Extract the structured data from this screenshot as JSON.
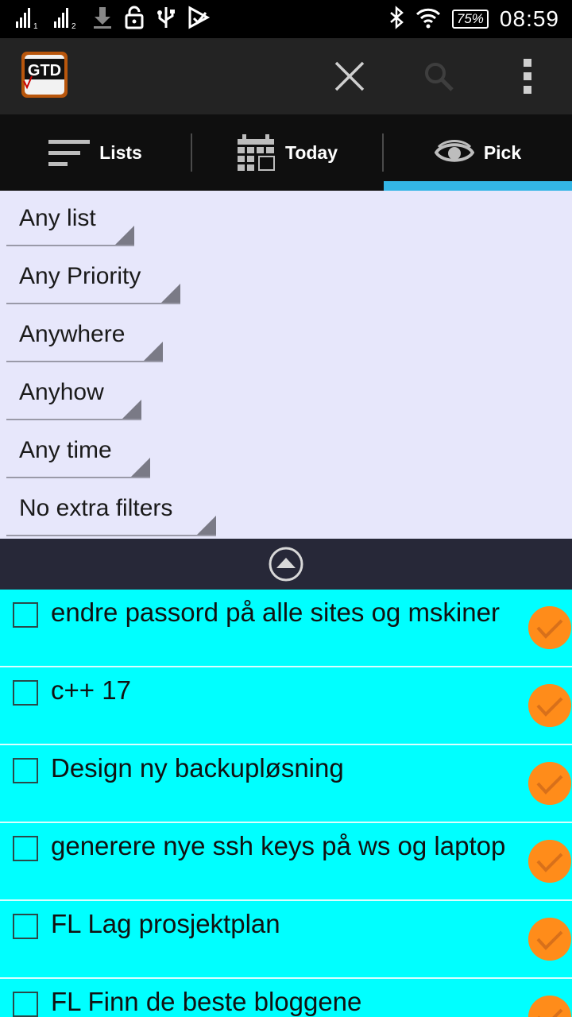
{
  "status_bar": {
    "signal1_sub": "1",
    "signal2_sub": "2",
    "battery": "75%",
    "time": "08:59"
  },
  "action_bar": {
    "logo_text": "GTD"
  },
  "tabs": [
    {
      "label": "Lists",
      "icon": "lists-icon"
    },
    {
      "label": "Today",
      "icon": "calendar-icon"
    },
    {
      "label": "Pick",
      "icon": "eye-icon",
      "selected": true
    }
  ],
  "filters": [
    {
      "value": "Any list"
    },
    {
      "value": "Any Priority"
    },
    {
      "value": "Anywhere"
    },
    {
      "value": "Anyhow"
    },
    {
      "value": "Any time"
    },
    {
      "value": "No extra filters"
    }
  ],
  "tasks": [
    {
      "text": "endre passord på alle sites og mskiner"
    },
    {
      "text": "c++ 17"
    },
    {
      "text": "Design ny backupløsning"
    },
    {
      "text": "generere nye ssh keys på ws og laptop"
    },
    {
      "text": "FL Lag prosjektplan"
    },
    {
      "text": "FL Finn de beste bloggene"
    }
  ],
  "colors": {
    "accent": "#33b5e5",
    "task_bg": "#00ffff",
    "filters_bg": "#e7e7fb",
    "done_button": "#ff8c1a"
  }
}
